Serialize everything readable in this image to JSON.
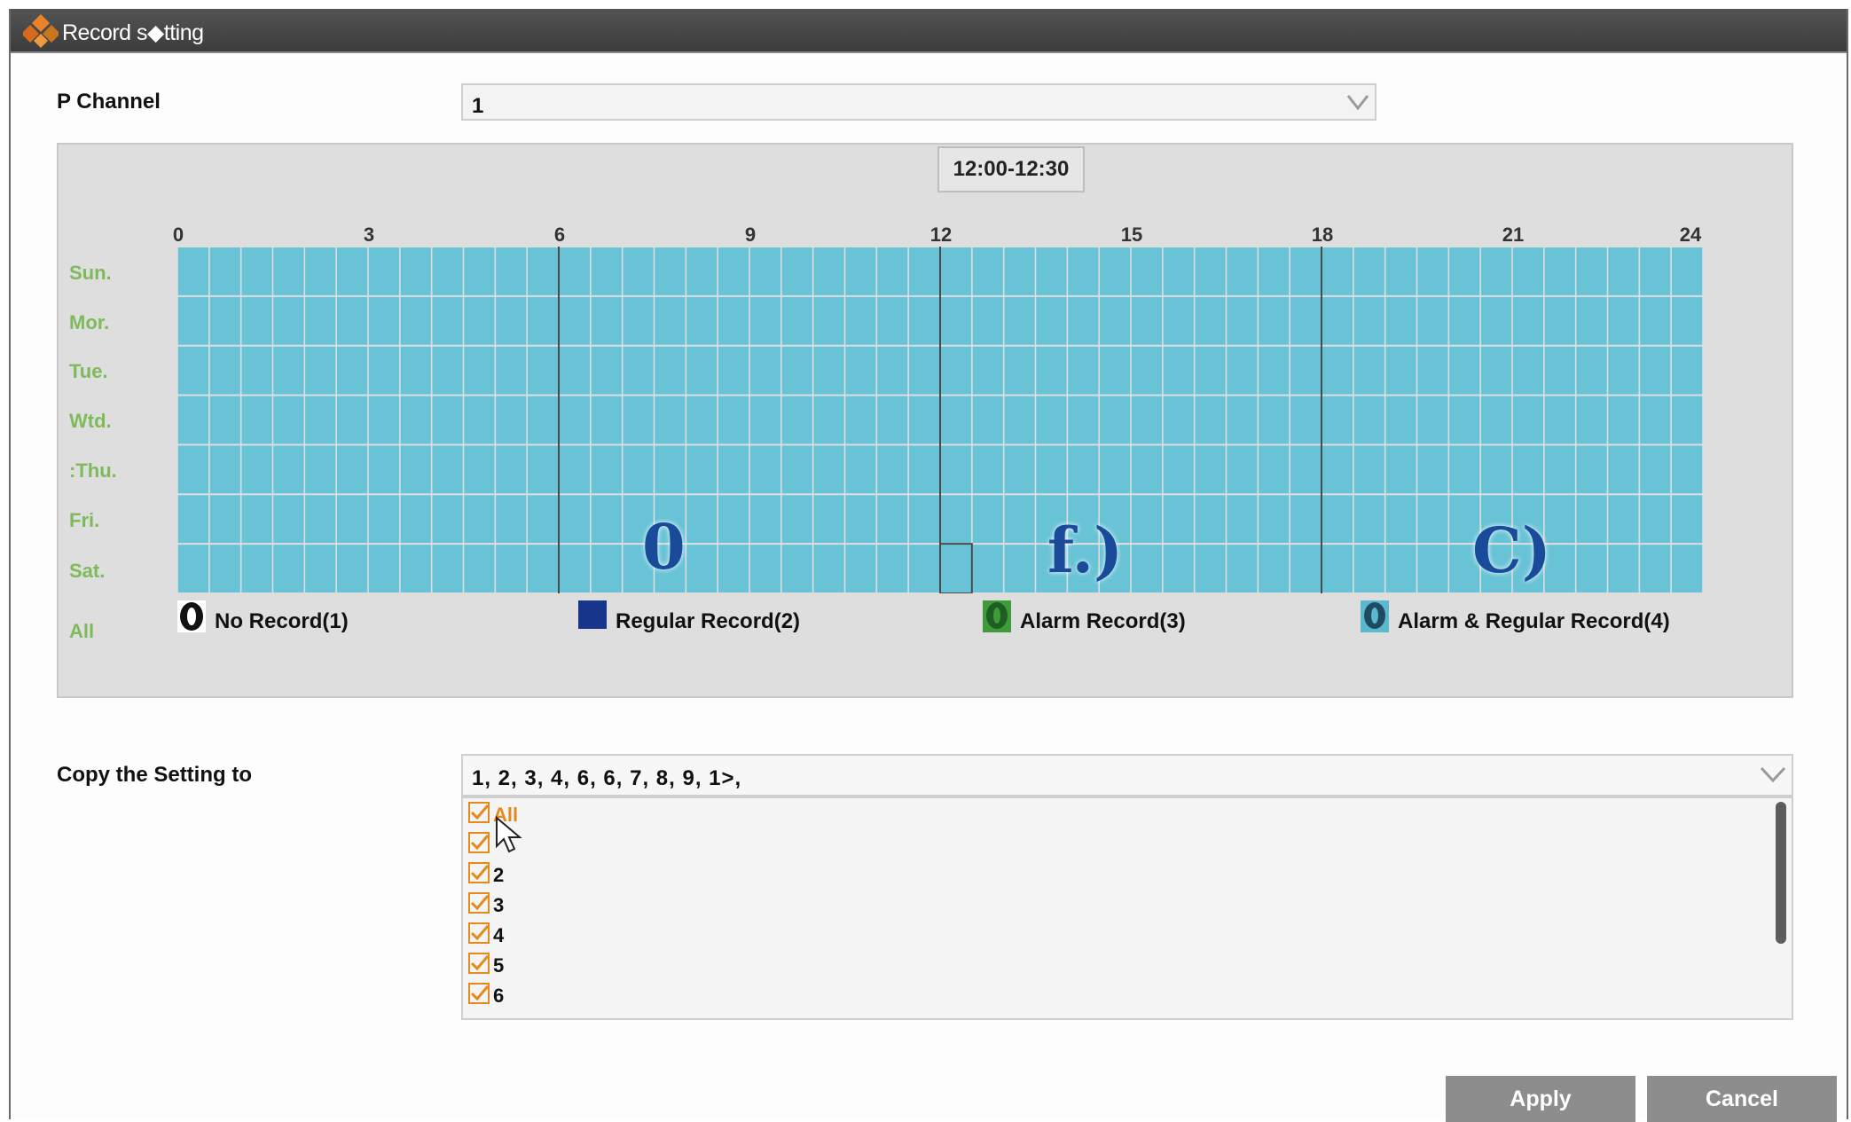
{
  "window": {
    "title": "Record s◆tting"
  },
  "ip_channel": {
    "label": "P Channel",
    "value": "1"
  },
  "schedule": {
    "time_range": "12:00-12:30",
    "hours": [
      "0",
      "3",
      "6",
      "9",
      "12",
      "15",
      "18",
      "21",
      "24"
    ],
    "days": [
      "Sun.",
      "Mor.",
      "Tue.",
      "Wtd.",
      ":Thu.",
      "Fri.",
      "Sat."
    ],
    "all_label": "All",
    "cell_color": "#68c3d6",
    "overlay_marks": [
      "0",
      "f.)",
      "C)"
    ]
  },
  "legend": [
    {
      "label": "No Record(1)",
      "color": "#ffffff",
      "icon": "no-record-icon"
    },
    {
      "label": "Regular Record(2)",
      "color": "#17358a",
      "icon": "regular-record-icon"
    },
    {
      "label": "Alarm Record(3)",
      "color": "#3f9a3a",
      "icon": "alarm-record-icon"
    },
    {
      "label": "Alarm & Regular Record(4)",
      "color": "#5bb9cf",
      "icon": "alarm-regular-record-icon"
    }
  ],
  "copy": {
    "label": "Copy the Setting to",
    "value": "1, 2, 3, 4, 6, 6, 7, 8, 9, 1>,",
    "options": [
      "All",
      "",
      "2",
      "3",
      "4",
      "5",
      "6"
    ]
  },
  "buttons": {
    "apply": "Apply",
    "cancel": "Cancel"
  }
}
